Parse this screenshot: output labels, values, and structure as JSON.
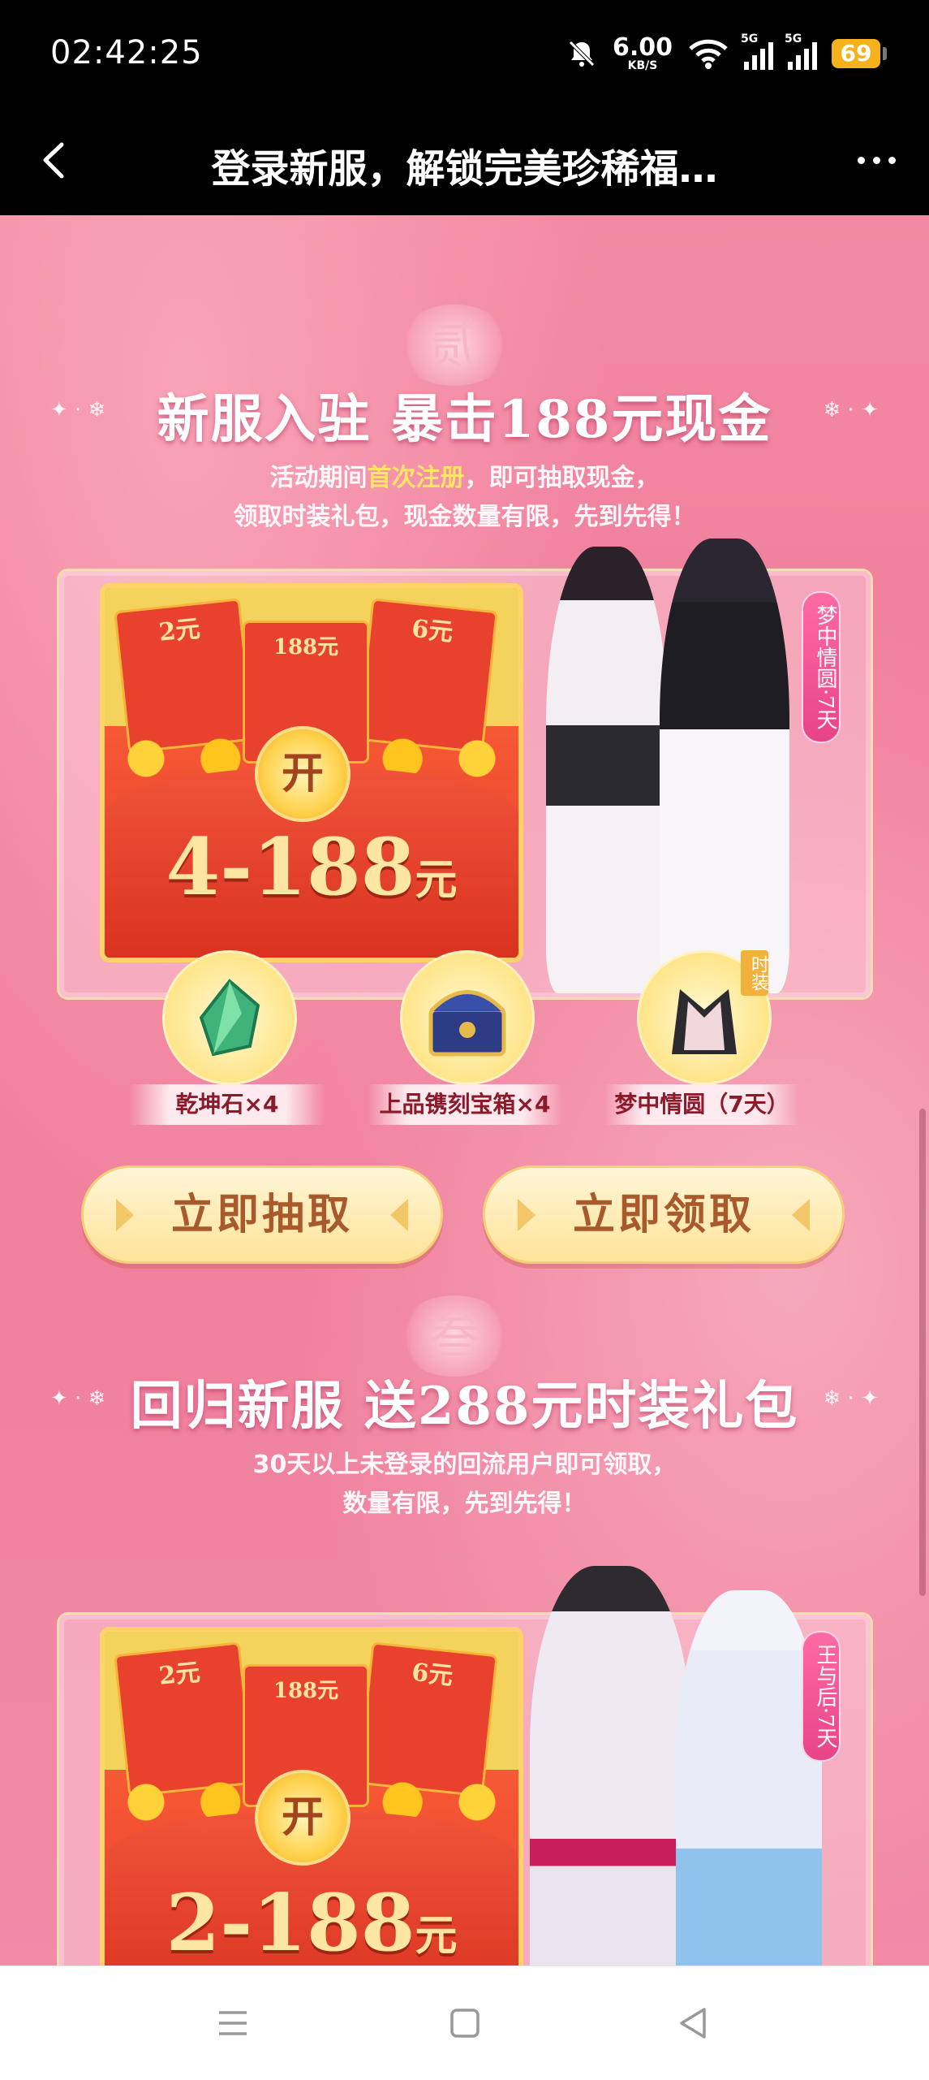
{
  "status_bar": {
    "time": "02:42:25",
    "net_speed_value": "6.00",
    "net_speed_unit": "KB/S",
    "signal1_label": "5G",
    "signal2_label": "5G",
    "battery": "69"
  },
  "nav_bar": {
    "title": "登录新服，解锁完美珍稀福…"
  },
  "section2": {
    "numeral": "贰",
    "title": "新服入驻 暴击188元现金",
    "desc_line1_pre": "活动期间",
    "desc_line1_hl": "首次注册",
    "desc_line1_post": "，即可抽取现金，",
    "desc_line2": "领取时装礼包，现金数量有限，先到先得！",
    "envelope_left": "2元",
    "envelope_mid": "188元",
    "envelope_right": "6元",
    "open_label": "开",
    "amount": "4-188",
    "amount_unit": "元",
    "side_tag": "梦中情圆·7天",
    "rewards": [
      {
        "label": "乾坤石×4",
        "icon": "gem-icon"
      },
      {
        "label": "上品镌刻宝箱×4",
        "icon": "treasure-chest-icon"
      },
      {
        "label": "梦中情圆（7天）",
        "icon": "costume-icon",
        "badge": "时装"
      }
    ],
    "draw_button": "立即抽取",
    "claim_button": "立即领取"
  },
  "section3": {
    "numeral": "叁",
    "title": "回归新服 送288元时装礼包",
    "desc_line1": "30天以上未登录的回流用户即可领取，",
    "desc_line2": "数量有限，先到先得！",
    "envelope_left": "2元",
    "envelope_mid": "188元",
    "envelope_right": "6元",
    "open_label": "开",
    "amount": "2-188",
    "amount_unit": "元",
    "side_tag": "王与后·7天"
  },
  "colors": {
    "page_pink": "#f28aa3",
    "envelope_red": "#e63c2a",
    "gold": "#ffd36a",
    "highlight_yellow": "#ffe566"
  }
}
